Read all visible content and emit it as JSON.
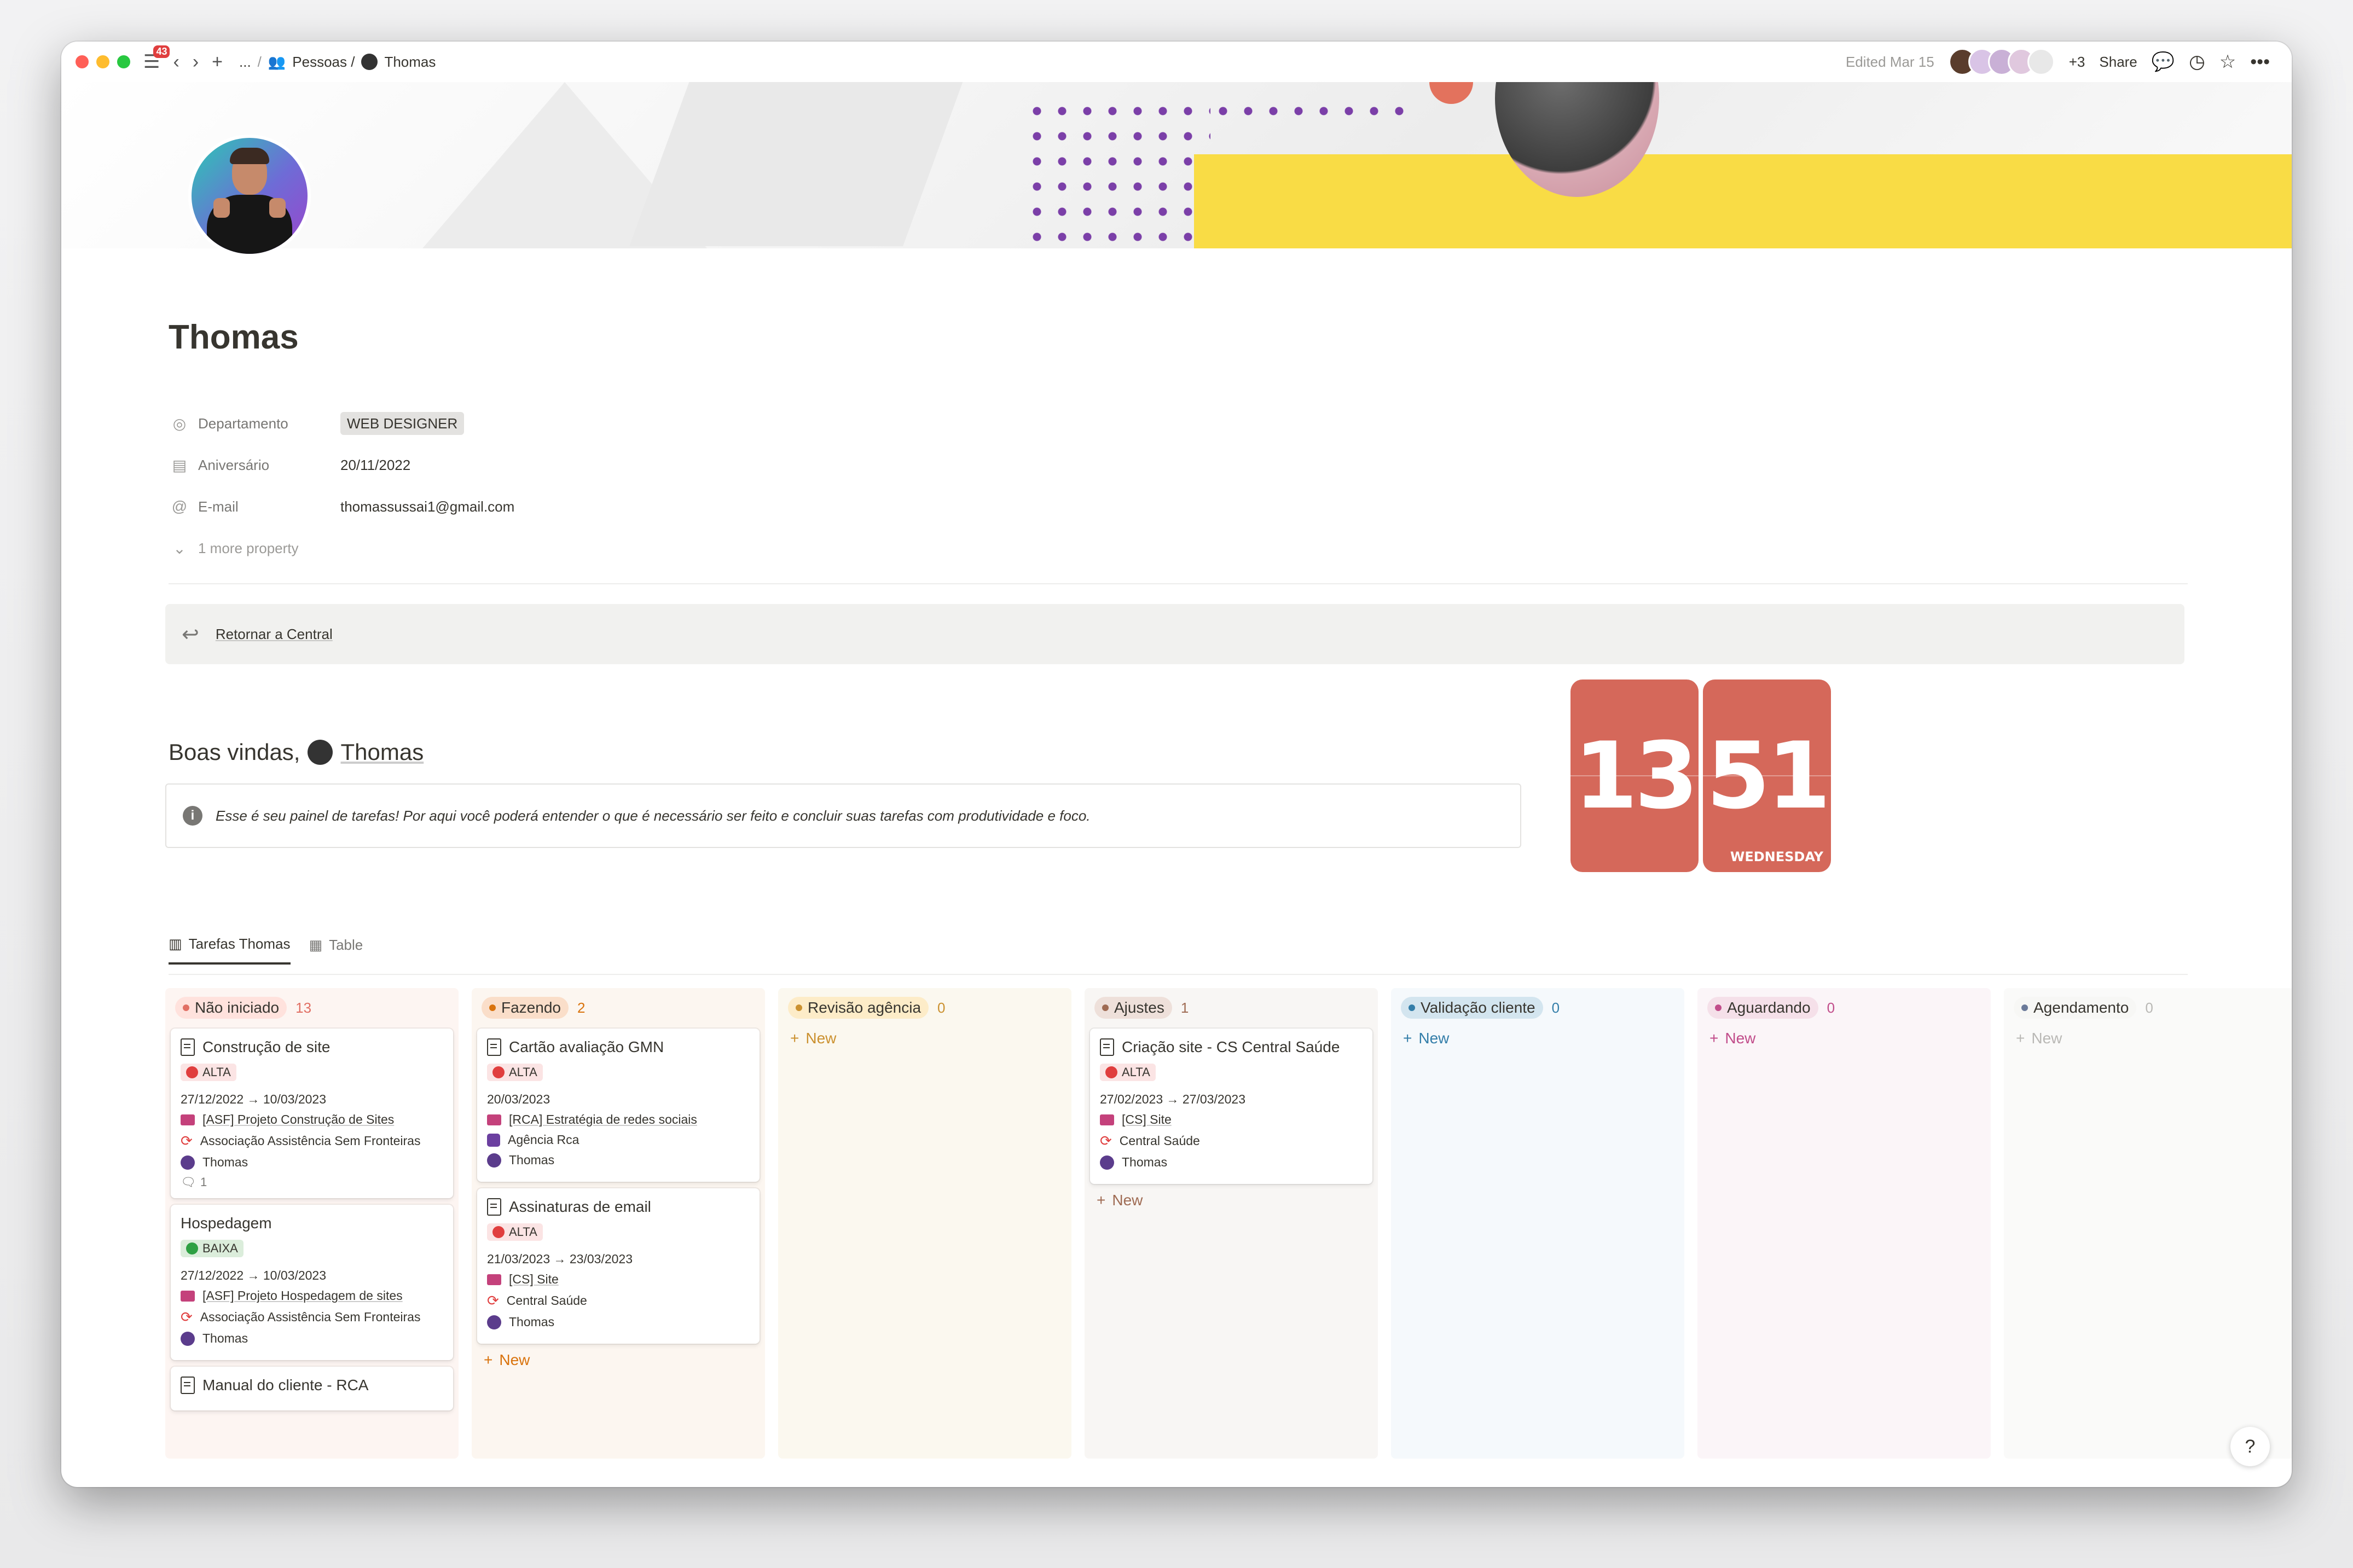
{
  "topbar": {
    "notif_count": "43",
    "breadcrumb_ellipsis": "...",
    "breadcrumb_parent": "Pessoas /",
    "breadcrumb_page": "Thomas",
    "edited": "Edited Mar 15",
    "more_avatars": "+3",
    "share": "Share"
  },
  "page": {
    "title": "Thomas",
    "properties": [
      {
        "key": "Departamento",
        "value": "WEB DESIGNER"
      },
      {
        "key": "Aniversário",
        "value": "20/11/2022"
      },
      {
        "key": "E-mail",
        "value": "thomassussai1@gmail.com"
      }
    ],
    "more_property": "1 more property",
    "return_label": "Retornar a Central",
    "welcome_prefix": "Boas vindas,",
    "welcome_name": "Thomas",
    "info_text": "Esse é seu painel de tarefas! Por aqui você poderá entender o que é necessário ser feito e concluir suas tarefas com produtividade e foco."
  },
  "clock": {
    "hour": "13",
    "minute": "51",
    "day": "WEDNESDAY"
  },
  "views": {
    "board": "Tarefas Thomas",
    "table": "Table"
  },
  "board": {
    "new_label": "New",
    "columns": [
      {
        "name": "Não iniciado",
        "count": "13",
        "bg": "#fdf5f2",
        "pill": "#ffe2dd",
        "dot": "#e16f64",
        "countColor": "#e16f64",
        "cards": [
          {
            "title": "Construção de site",
            "priority": "ALTA",
            "dates": "27/12/2022 → 10/03/2023",
            "project": "[ASF] Projeto Construção de Sites",
            "client": "Associação Assistência Sem Fronteiras",
            "owner": "Thomas",
            "comments": "1"
          },
          {
            "title": "Hospedagem",
            "priority": "BAIXA",
            "dates": "27/12/2022 → 10/03/2023",
            "project": "[ASF] Projeto Hospedagem de sites",
            "client": "Associação Assistência Sem Fronteiras",
            "owner": "Thomas"
          },
          {
            "title": "Manual do cliente - RCA"
          }
        ]
      },
      {
        "name": "Fazendo",
        "count": "2",
        "bg": "#fcf6f0",
        "pill": "#fadec9",
        "dot": "#d9730d",
        "countColor": "#d9730d",
        "cards": [
          {
            "title": "Cartão avaliação GMN",
            "priority": "ALTA",
            "dates": "20/03/2023",
            "project": "[RCA] Estratégia de redes sociais",
            "client": "Agência Rca",
            "owner": "Thomas"
          },
          {
            "title": "Assinaturas de email",
            "priority": "ALTA",
            "dates": "21/03/2023 → 23/03/2023",
            "project": "[CS] Site",
            "client": "Central Saúde",
            "owner": "Thomas"
          }
        ]
      },
      {
        "name": "Revisão agência",
        "count": "0",
        "bg": "#fbf8ef",
        "pill": "#fdecc8",
        "dot": "#cb912f",
        "countColor": "#cb912f",
        "cards": []
      },
      {
        "name": "Ajustes",
        "count": "1",
        "bg": "#f8f6f4",
        "pill": "#eee0da",
        "dot": "#9f6b53",
        "countColor": "#9f6b53",
        "cards": [
          {
            "title": "Criação site - CS Central Saúde",
            "priority": "ALTA",
            "dates": "27/02/2023 → 27/03/2023",
            "project": "[CS] Site",
            "client": "Central Saúde",
            "owner": "Thomas"
          }
        ]
      },
      {
        "name": "Validação cliente",
        "count": "0",
        "bg": "#f5f9fc",
        "pill": "#d3e5ef",
        "dot": "#337ea9",
        "countColor": "#337ea9",
        "cards": []
      },
      {
        "name": "Aguardando",
        "count": "0",
        "bg": "#fbf5f8",
        "pill": "#f5e0e9",
        "dot": "#c14c8a",
        "countColor": "#c14c8a",
        "cards": []
      },
      {
        "name": "Agendamento",
        "count": "0",
        "bg": "#fafaf9",
        "pill": "#f7f7f5",
        "dot": "#6b7a99",
        "countColor": "#b9b8b5",
        "cards": []
      }
    ]
  },
  "help": "?"
}
